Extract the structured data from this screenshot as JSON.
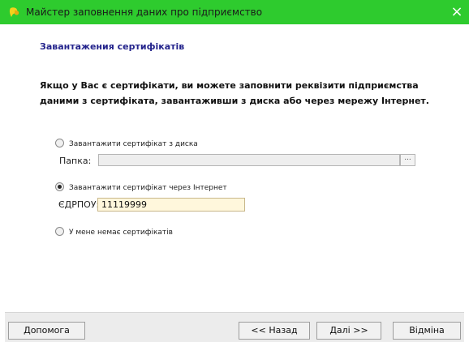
{
  "window": {
    "title": "Майстер заповнення даних про підприємство",
    "close_icon": "×",
    "accent_color": "#2ecb2e"
  },
  "wizard": {
    "step_title": "Завантажения сертифікатів",
    "intro_line1": "Якщо у Вас є сертифікати, ви можете заповнити реквізити підприємства",
    "intro_line2": "даними з сертифіката, завантаживши з диска або через мережу Інтернет."
  },
  "options": {
    "from_disk_label": "Завантажити сертифікат з диска",
    "from_internet_label": "Завантажити сертифікат через Інтернет",
    "none_label": "У мене немає сертифікатів",
    "selected": "from_internet"
  },
  "folder": {
    "label": "Папка:",
    "value": "",
    "browse_label": "..."
  },
  "edrpou": {
    "label": "ЄДРПОУ:",
    "value": "11119999"
  },
  "buttons": {
    "help": "Допомога",
    "back": "<< Назад",
    "next": "Далі >>",
    "cancel": "Відміна"
  }
}
